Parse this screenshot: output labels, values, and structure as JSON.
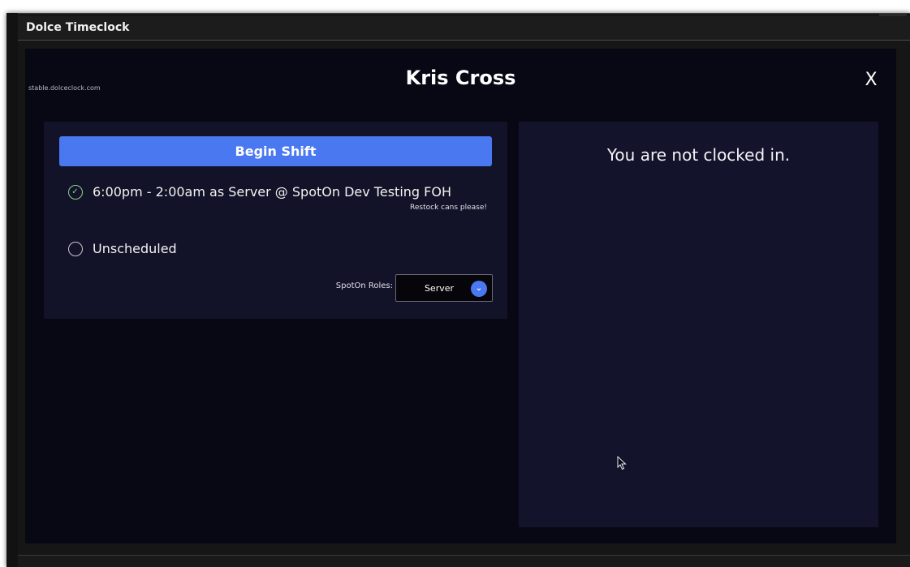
{
  "window": {
    "title": "Dolce Timeclock"
  },
  "app": {
    "domain": "stable.dolceclock.com",
    "employee_name": "Kris Cross",
    "close_label": "X"
  },
  "left_panel": {
    "begin_shift_label": "Begin Shift",
    "options": [
      {
        "label": "6:00pm - 2:00am as Server @ SpotOn Dev Testing FOH",
        "note": "Restock cans please!",
        "selected": true
      },
      {
        "label": "Unscheduled",
        "selected": false
      }
    ],
    "roles_label": "SpotOn Roles:",
    "roles_value": "Server"
  },
  "right_panel": {
    "status": "You are not clocked in."
  },
  "colors": {
    "accent": "#4a78f0",
    "check": "#8fd18f",
    "background": "#080814",
    "panel": "#121228"
  },
  "icons": {
    "check": "check-circle-icon",
    "radio": "radio-empty-icon",
    "chevron": "chevron-down-icon",
    "close": "close-icon",
    "cursor": "mouse-cursor-icon"
  }
}
